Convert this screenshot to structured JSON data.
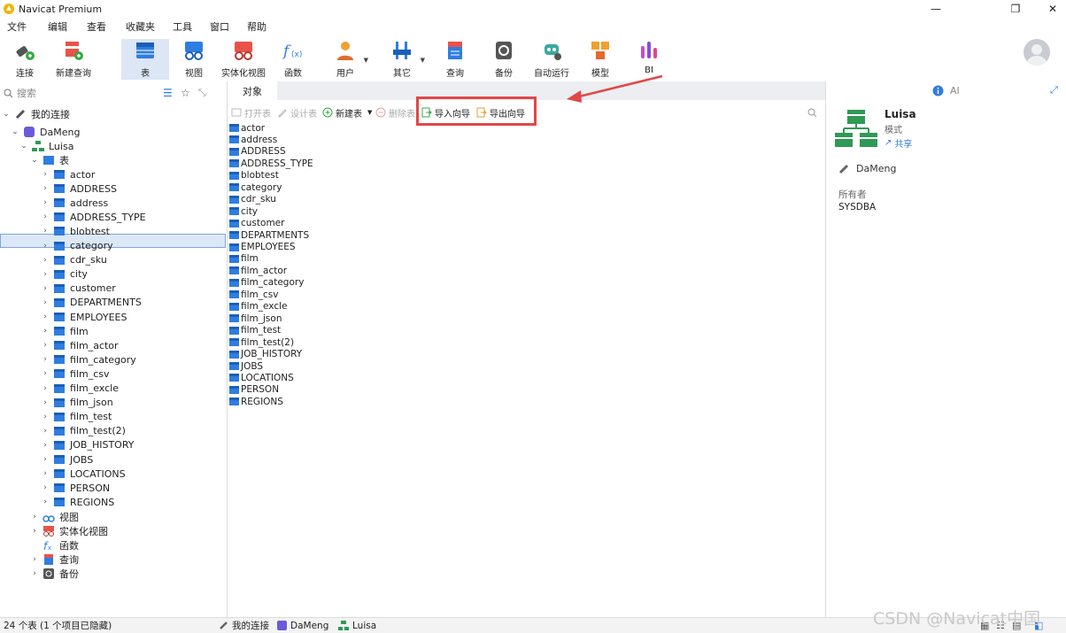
{
  "window": {
    "title": "Navicat Premium",
    "minimize": "—",
    "maximize": "❐",
    "close": "✕"
  },
  "menu": [
    "文件",
    "编辑",
    "查看",
    "收藏夹",
    "工具",
    "窗口",
    "帮助"
  ],
  "toolbar": {
    "connect": "连接",
    "new_query": "新建查询",
    "table": "表",
    "view": "视图",
    "materialized_view": "实体化视图",
    "function": "函数",
    "user": "用户",
    "other": "其它",
    "query": "查询",
    "backup": "备份",
    "automation": "自动运行",
    "model": "模型",
    "bi": "BI"
  },
  "sidebar": {
    "search_placeholder": "搜索",
    "root": "我的连接",
    "connection": "DaMeng",
    "schema": "Luisa",
    "tables_group": "表",
    "tables": [
      "actor",
      "ADDRESS",
      "address",
      "ADDRESS_TYPE",
      "blobtest",
      "category",
      "cdr_sku",
      "city",
      "customer",
      "DEPARTMENTS",
      "EMPLOYEES",
      "film",
      "film_actor",
      "film_category",
      "film_csv",
      "film_excle",
      "film_json",
      "film_test",
      "film_test(2)",
      "JOB_HISTORY",
      "JOBS",
      "LOCATIONS",
      "PERSON",
      "REGIONS"
    ],
    "groups": [
      "视图",
      "实体化视图",
      "函数",
      "查询",
      "备份"
    ]
  },
  "objects": {
    "tab": "对象",
    "open_table": "打开表",
    "design_table": "设计表",
    "new_table": "新建表",
    "delete_table": "删除表",
    "import_wizard": "导入向导",
    "export_wizard": "导出向导",
    "items": [
      "actor",
      "address",
      "ADDRESS",
      "ADDRESS_TYPE",
      "blobtest",
      "category",
      "cdr_sku",
      "city",
      "customer",
      "DEPARTMENTS",
      "EMPLOYEES",
      "film",
      "film_actor",
      "film_category",
      "film_csv",
      "film_excle",
      "film_json",
      "film_test",
      "film_test(2)",
      "JOB_HISTORY",
      "JOBS",
      "LOCATIONS",
      "PERSON",
      "REGIONS"
    ]
  },
  "info": {
    "ai": "AI",
    "name": "Luisa",
    "type": "模式",
    "share": "共享",
    "connection": "DaMeng",
    "owner_label": "所有者",
    "owner": "SYSDBA"
  },
  "status": {
    "count": "24 个表 (1 个项目已隐藏)",
    "crumb_root": "我的连接",
    "crumb_conn": "DaMeng",
    "crumb_schema": "Luisa"
  },
  "watermark": "CSDN @Navicat中国",
  "colors": {
    "accent": "#2f7de1",
    "highlight": "#e04848",
    "selection": "#dce8f6"
  }
}
